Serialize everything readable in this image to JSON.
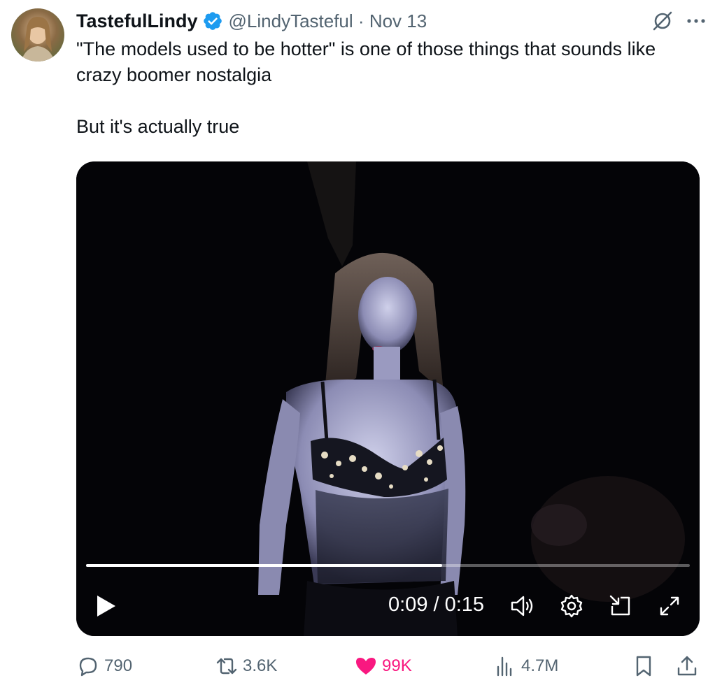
{
  "author": {
    "display_name": "TastefulLindy",
    "handle": "@LindyTasteful",
    "date": "Nov 13",
    "separator": "·",
    "verified": true,
    "verified_color": "#1d9bf0"
  },
  "header_icons": [
    "grok-icon",
    "more-icon"
  ],
  "tweet": {
    "paragraphs": [
      "\"The models used to be hotter\" is one of those things that sounds like crazy boomer nostalgia",
      "But it's actually true"
    ]
  },
  "video": {
    "current_time": "0:09",
    "duration": "0:15",
    "time_display": "0:09 / 0:15",
    "progress_fraction": 0.59,
    "controls": [
      "play-icon",
      "volume-icon",
      "settings-icon",
      "picture-in-picture-icon",
      "fullscreen-icon"
    ]
  },
  "actions": {
    "replies": "790",
    "reposts": "3.6K",
    "likes": "99K",
    "views": "4.7M",
    "liked": true,
    "like_color": "#f91880",
    "icon_color": "#536471"
  }
}
